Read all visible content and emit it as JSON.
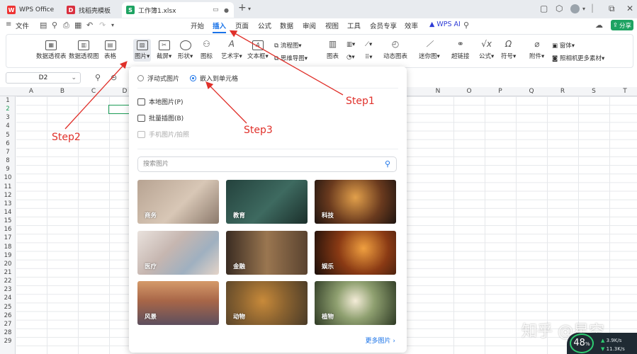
{
  "titlebar": {
    "tabs": [
      {
        "label": "WPS Office",
        "icon": "wps-icon"
      },
      {
        "label": "找稻壳模板",
        "icon": "docer-icon"
      },
      {
        "label": "工作簿1.xlsx",
        "icon": "sheet-icon"
      }
    ],
    "new_tab": "+"
  },
  "menubar": {
    "file": "文件",
    "items": [
      "开始",
      "插入",
      "页面",
      "公式",
      "数据",
      "审阅",
      "视图",
      "工具",
      "会员专享",
      "效率",
      "WPS AI"
    ],
    "active": "插入",
    "share": "分享"
  },
  "ribbon": {
    "buttons": [
      "数据透视表",
      "数据透视图",
      "表格",
      "图片",
      "截屏",
      "形状",
      "图标",
      "艺术字",
      "文本框",
      "图表",
      "动态图表",
      "迷你图",
      "超链接",
      "公式",
      "符号",
      "附件",
      "更多素材"
    ],
    "small": [
      "流程图",
      "思维导图",
      "窗体",
      "照相机"
    ]
  },
  "formula_bar": {
    "cell_ref": "D2"
  },
  "sheet": {
    "columns": [
      "A",
      "B",
      "C",
      "D",
      "N",
      "O",
      "P",
      "Q",
      "R",
      "S",
      "T"
    ],
    "rows": [
      "1",
      "2",
      "3",
      "4",
      "5",
      "6",
      "7",
      "8",
      "9",
      "10",
      "11",
      "12",
      "13",
      "14",
      "15",
      "16",
      "17",
      "18",
      "19",
      "20",
      "21",
      "22",
      "23",
      "24",
      "25",
      "26",
      "27",
      "28",
      "29"
    ]
  },
  "picture_panel": {
    "mode_floating": "浮动式图片",
    "mode_embed": "嵌入到单元格",
    "selected_mode": "embed",
    "items": [
      {
        "label": "本地图片(P)",
        "enabled": true
      },
      {
        "label": "批量插图(B)",
        "enabled": true
      },
      {
        "label": "手机图片/拍照",
        "enabled": false
      }
    ],
    "search_placeholder": "搜索图片",
    "categories": [
      "商务",
      "教育",
      "科技",
      "医疗",
      "金融",
      "娱乐",
      "风景",
      "动物",
      "植物"
    ],
    "more": "更多图片"
  },
  "annotations": {
    "step1": "Step1",
    "step2": "Step2",
    "step3": "Step3"
  },
  "watermark": "知乎 @星空",
  "net_widget": {
    "percent": "48",
    "percent_unit": "%",
    "up": "3.9",
    "down": "11.3",
    "unit": "K/s"
  },
  "colors": {
    "accent": "#1a73e8",
    "annotation": "#e0302a",
    "share": "#1ea362",
    "selection": "#1e9e58"
  }
}
